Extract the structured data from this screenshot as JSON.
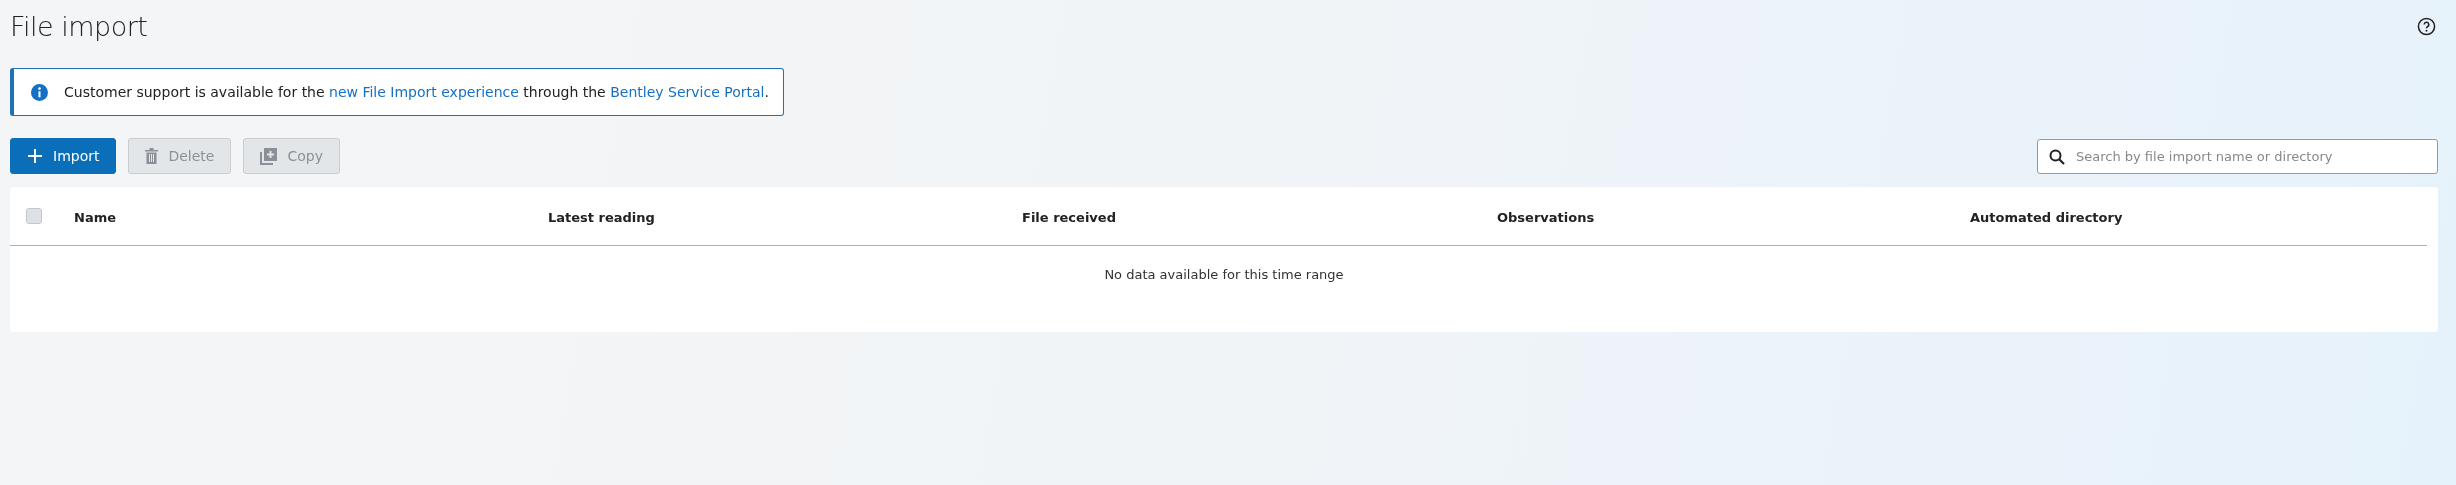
{
  "page": {
    "title": "File import"
  },
  "banner": {
    "parts": [
      {
        "kind": "text",
        "text": "Customer support is available for the "
      },
      {
        "kind": "link",
        "text": "new File Import experience"
      },
      {
        "kind": "text",
        "text": " through the "
      },
      {
        "kind": "link",
        "text": "Bentley Service Portal"
      },
      {
        "kind": "text",
        "text": "."
      }
    ]
  },
  "toolbar": {
    "buttons": [
      {
        "label": "Import",
        "kind": "add",
        "disabled": false,
        "primary": true
      },
      {
        "label": "Delete",
        "kind": "delete",
        "disabled": true,
        "primary": false
      },
      {
        "label": "Copy",
        "kind": "copy",
        "disabled": true,
        "primary": false
      }
    ]
  },
  "search": {
    "placeholder": "Search by file import name or directory"
  },
  "table": {
    "select_all": {
      "checked": false
    },
    "columns": [
      "Name",
      "Latest reading",
      "File received",
      "Observations",
      "Automated directory"
    ],
    "empty_message": "No data available for this time range"
  }
}
